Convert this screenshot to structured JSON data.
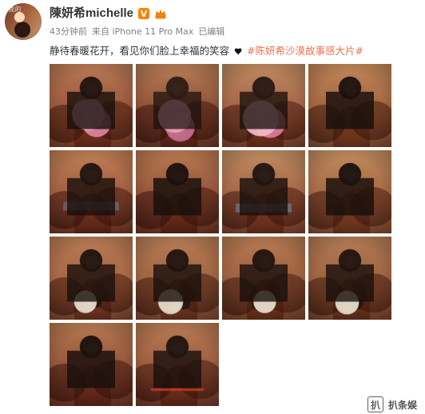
{
  "post": {
    "user": {
      "display_name": "陳妍希michelle",
      "avatar_text": "我的"
    },
    "meta": {
      "time_ago": "43分钟前",
      "source": "来自 iPhone 11 Pro Max",
      "edited": "已编辑"
    },
    "content": {
      "text": "静待春暖花开，看见你们脸上幸福的笑容",
      "hashtag": "#陈妍希沙漠故事感大片#"
    },
    "photos": {
      "count": 14
    },
    "watermark": {
      "label": "扒条娱"
    },
    "colors": {
      "hashtag": "#eb7350",
      "verified": "#ff8200"
    }
  }
}
